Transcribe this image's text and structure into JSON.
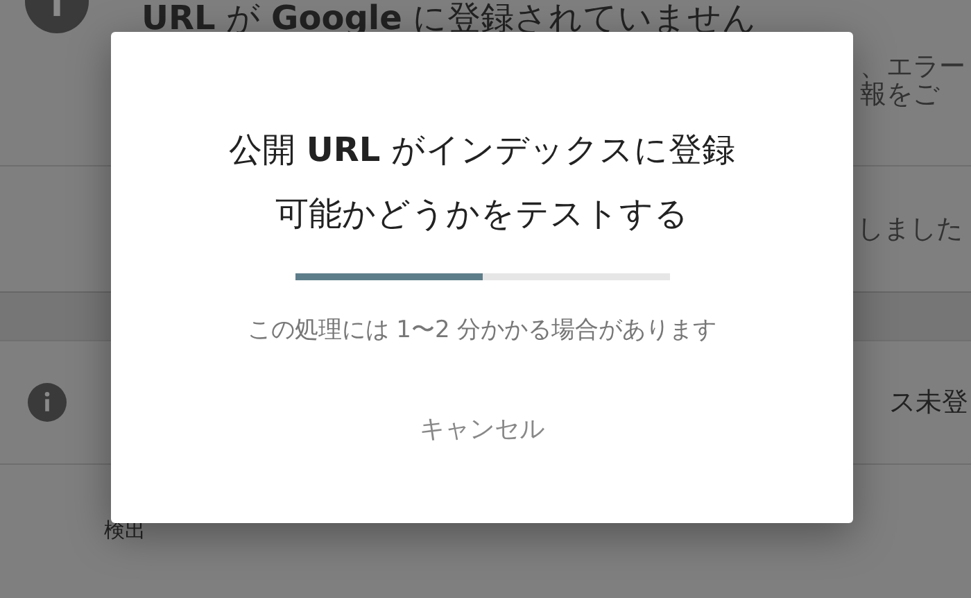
{
  "background": {
    "title": "**URL** が **Google** に登録されていません",
    "snippet_lines": [
      "、エラー",
      "報をご"
    ],
    "row_2_text": "しました",
    "row_3_text": "ス未登",
    "section_label": "検出"
  },
  "dialog": {
    "title": "公開 **URL** がインデックスに登録可能かどうかをテストする",
    "progress": {
      "level": 0.5
    },
    "message": "この処理には 1〜2 分かかる場合があります",
    "buttons": [
      "キャンセル"
    ]
  }
}
